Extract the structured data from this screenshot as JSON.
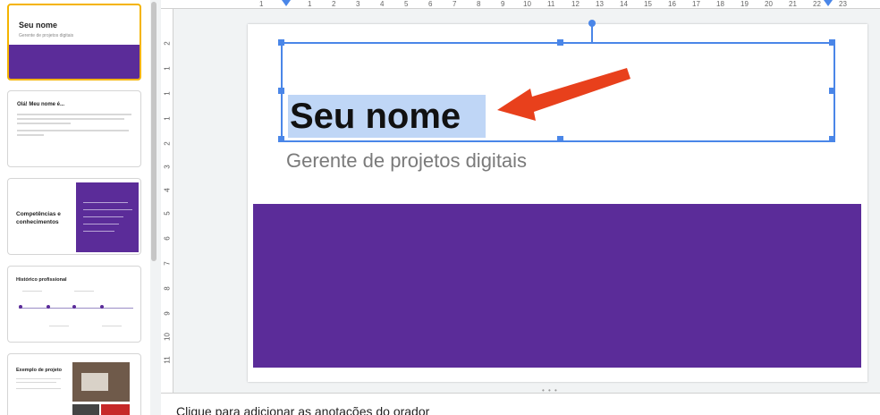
{
  "filmstrip": {
    "slides": [
      {
        "title": "Seu nome",
        "subtitle": "Gerente de projetos digitais"
      },
      {
        "title": "Olá! Meu nome é..."
      },
      {
        "title": "Competências e conhecimentos"
      },
      {
        "title": "Histórico profissional"
      },
      {
        "title": "Exemplo de projeto"
      }
    ]
  },
  "ruler": {
    "top_numbers": [
      "1",
      "1",
      "2",
      "3",
      "4",
      "5",
      "6",
      "7",
      "8",
      "9",
      "10",
      "11",
      "12",
      "13",
      "14",
      "15",
      "16",
      "17",
      "18",
      "19",
      "20",
      "21",
      "22",
      "23"
    ],
    "left_numbers": [
      "2",
      "1",
      "1",
      "1",
      "2",
      "3",
      "4",
      "5",
      "6",
      "7",
      "8",
      "9",
      "10",
      "11"
    ]
  },
  "slide": {
    "title": "Seu nome",
    "subtitle": "Gerente de projetos digitais",
    "band_color": "#5b2c99"
  },
  "notes": {
    "placeholder": "Clique para adicionar as anotações do orador"
  },
  "colors": {
    "selection": "#4a86e8",
    "highlight": "#bfd6f6",
    "arrow": "#e8401c",
    "selected_thumb_border": "#f4b400"
  }
}
